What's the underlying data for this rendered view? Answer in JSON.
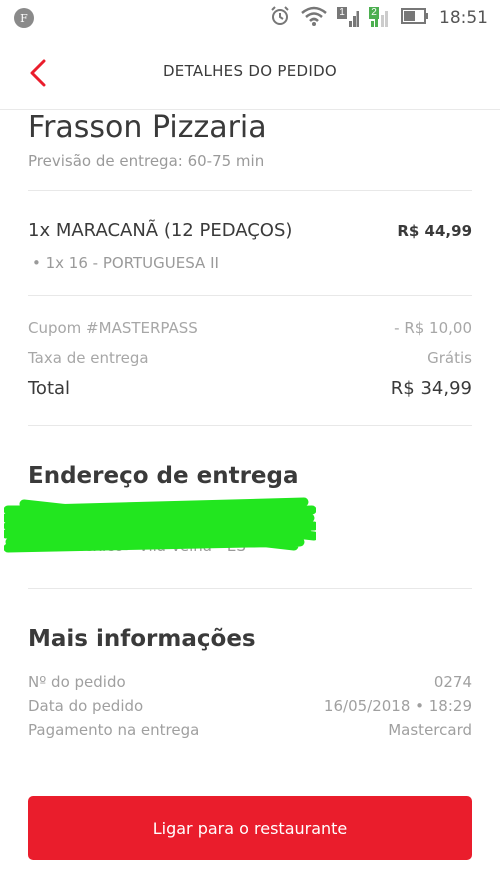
{
  "status_bar": {
    "time": "18:51",
    "sim1": "1",
    "sim2": "2",
    "notification_letter": "F"
  },
  "header": {
    "title": "DETALHES DO PEDIDO"
  },
  "restaurant": {
    "name": "Frasson Pizzaria",
    "delivery_estimate": "Previsão de entrega: 60-75 min"
  },
  "order": {
    "items": [
      {
        "name": "1x MARACANÃ (12 PEDAÇOS)",
        "price": "R$ 44,99",
        "sub": "• 1x 16 - PORTUGUESA II"
      }
    ]
  },
  "summary": {
    "coupon_label": "Cupom #MASTERPASS",
    "coupon_value": "- R$ 10,00",
    "fee_label": "Taxa de entrega",
    "fee_value": "Grátis",
    "total_label": "Total",
    "total_value": "R$ 34,99"
  },
  "address": {
    "title": "Endereço de entrega",
    "line": "Novo Mexico - Vila Velha - ES"
  },
  "more_info": {
    "title": "Mais informações",
    "order_number_label": "Nº do pedido",
    "order_number_value": "0274",
    "date_label": "Data do pedido",
    "date_value": "16/05/2018 • 18:29",
    "payment_label": "Pagamento na entrega",
    "payment_value": "Mastercard"
  },
  "actions": {
    "call_label": "Ligar para o restaurante"
  },
  "colors": {
    "accent": "#ea1d2c",
    "redaction": "#22e61f"
  }
}
